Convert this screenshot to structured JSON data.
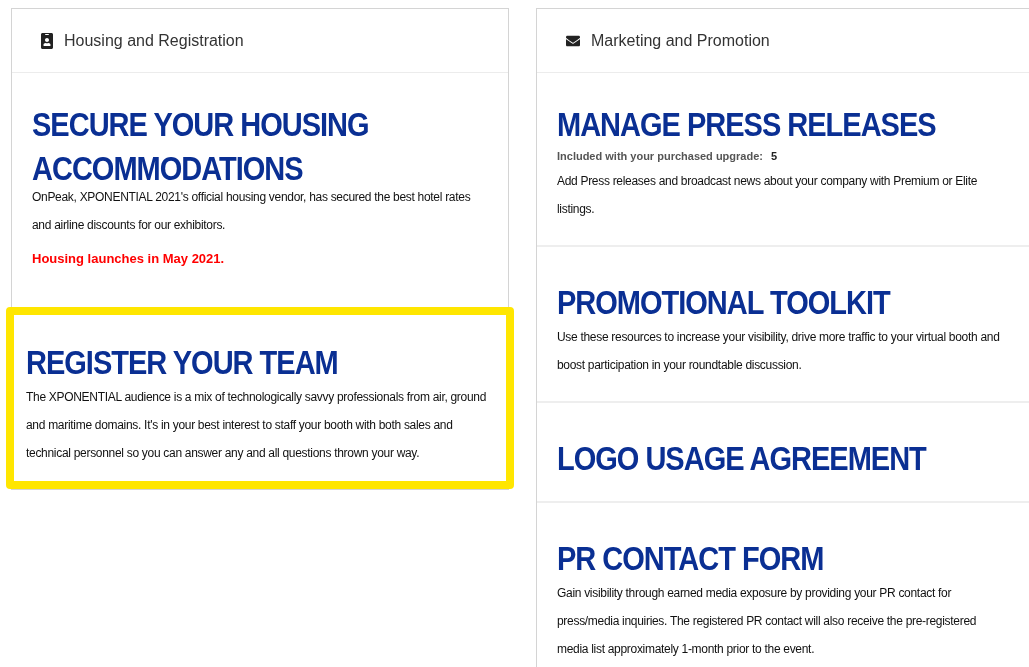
{
  "panels": [
    {
      "title": "Housing and Registration",
      "kind": "badge",
      "divided": false,
      "sections": [
        {
          "heading": [
            "SECURE YOUR HOUSING",
            "ACCOMMODATIONS"
          ],
          "highlighted": false,
          "blocks": [
            {
              "kind": "text",
              "text": "OnPeak, XPONENTIAL 2021's official housing vendor, has secured the best hotel rates and airline discounts for our exhibitors."
            },
            {
              "kind": "alert",
              "text": "Housing launches in May 2021."
            }
          ]
        },
        {
          "heading": [
            "REGISTER YOUR TEAM"
          ],
          "highlighted": true,
          "blocks": [
            {
              "kind": "text",
              "text": "The XPONENTIAL audience is a mix of technologically savvy professionals from air, ground and maritime domains. It's in your best interest to staff your booth with both sales and technical personnel so you can answer any and all questions thrown your way."
            }
          ]
        }
      ]
    },
    {
      "title": "Marketing and Promotion",
      "kind": "envelope",
      "divided": true,
      "sections": [
        {
          "heading": [
            "MANAGE PRESS RELEASES"
          ],
          "highlighted": false,
          "blocks": [
            {
              "kind": "note",
              "label": "Included with your purchased upgrade:",
              "value": "5"
            },
            {
              "kind": "text",
              "text": "Add Press releases and broadcast news about your company with Premium or Elite listings."
            }
          ]
        },
        {
          "heading": [
            "PROMOTIONAL TOOLKIT"
          ],
          "highlighted": false,
          "blocks": [
            {
              "kind": "text",
              "text": "Use these resources to increase your visibility, drive more traffic to your virtual booth and boost participation in your roundtable discussion."
            }
          ]
        },
        {
          "heading": [
            "LOGO USAGE AGREEMENT"
          ],
          "highlighted": false
        },
        {
          "heading": [
            "PR CONTACT FORM"
          ],
          "highlighted": false,
          "blocks": [
            {
              "kind": "text",
              "text": "Gain visibility through earned media exposure by providing your PR contact for press/media inquiries. The registered PR contact will also receive the pre-registered media list approximately 1-month prior to the event."
            }
          ]
        }
      ]
    }
  ]
}
